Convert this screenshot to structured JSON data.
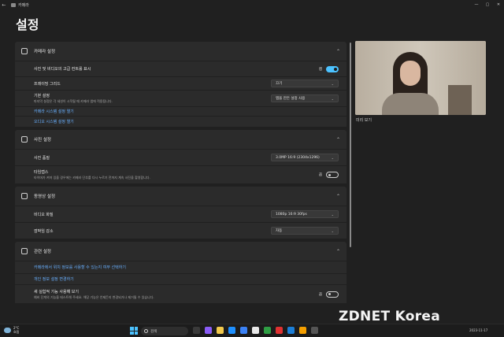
{
  "window": {
    "app_name": "카메라",
    "back_glyph": "←",
    "controls": [
      "—",
      "▢",
      "✕"
    ]
  },
  "page_title": "설정",
  "sections": {
    "camera": {
      "title": "카메라 설정",
      "icon": "camera-icon",
      "pro_controls": {
        "label": "사진 및 비디오의 고급 컨트롤 표시",
        "state": "켬",
        "on": true
      },
      "framing_grid": {
        "label": "프레이밍 그리드",
        "value": "끄기"
      },
      "default_settings": {
        "label": "기본 설정",
        "sub": "마지막 설정은 각 세션이 시작될 때 카메라 앱에 적용됩니다.",
        "value": "앱을 만든 설정 사용"
      },
      "link_camera_system": "카메라 시스템 설정 열기",
      "link_audio_system": "오디오 시스템 설정 열기"
    },
    "photo": {
      "title": "사진 설정",
      "icon": "image-icon",
      "quality": {
        "label": "사진 품질",
        "value": "3.0MP 16:9 (2304x1296)"
      },
      "timelapse": {
        "label": "타임랩스",
        "sub": "타이머가 켜져 있을 경우에는 카메라 단추를 다시 누르기 전까지 계속 사진을 촬영합니다.",
        "state": "끔",
        "on": false
      }
    },
    "video": {
      "title": "동영상 설정",
      "icon": "video-icon",
      "quality": {
        "label": "비디오 화질",
        "value": "1080p 16:9 30fps"
      },
      "flicker": {
        "label": "깜박임 감소",
        "value": "자동"
      }
    },
    "related": {
      "title": "관련 설정",
      "icon": "gear-icon",
      "link_location": "카메라에서 위치 정보를 사용할 수 있는지 여부 선택하기",
      "link_privacy": "개인 정보 설정 변경하기",
      "new_features": {
        "label": "새 실험적 기능 사용해 보기",
        "sub": "예비 단계의 기능을 테스트해 주세요. 해당 기능은 언제든지 변경되거나 제거될 수 있습니다.",
        "state": "끔",
        "on": false
      }
    }
  },
  "preview": {
    "label": "미리 보기"
  },
  "taskbar": {
    "weather_temp": "2°C",
    "weather_desc": "흐림",
    "search_placeholder": "검색",
    "date": "2023-11-17"
  },
  "watermark": "ZDNET Korea",
  "colors": {
    "accent": "#4cc2ff",
    "link": "#69b0ff",
    "card": "#2b2b2b",
    "background": "#202020"
  }
}
